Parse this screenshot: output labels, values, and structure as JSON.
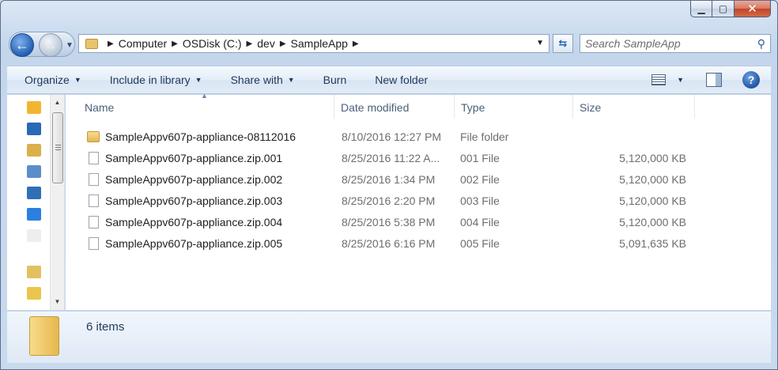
{
  "window": {
    "minimize_glyph": "▁",
    "maximize_glyph": "▢",
    "close_glyph": "✕"
  },
  "address_bar": {
    "crumbs": [
      "Computer",
      "OSDisk (C:)",
      "dev",
      "SampleApp"
    ]
  },
  "search": {
    "placeholder": "Search SampleApp"
  },
  "toolbar": {
    "organize_label": "Organize",
    "include_label": "Include in library",
    "share_label": "Share with",
    "burn_label": "Burn",
    "new_folder_label": "New folder"
  },
  "columns": {
    "name": "Name",
    "date": "Date modified",
    "type": "Type",
    "size": "Size"
  },
  "files": [
    {
      "name": "SampleAppv607p-appliance-08112016",
      "date": "8/10/2016 12:27 PM",
      "type": "File folder",
      "size": "",
      "icon": "folder-icon"
    },
    {
      "name": "SampleAppv607p-appliance.zip.001",
      "date": "8/25/2016 11:22 A...",
      "type": "001 File",
      "size": "5,120,000 KB",
      "icon": "file-icon"
    },
    {
      "name": "SampleAppv607p-appliance.zip.002",
      "date": "8/25/2016 1:34 PM",
      "type": "002 File",
      "size": "5,120,000 KB",
      "icon": "file-icon"
    },
    {
      "name": "SampleAppv607p-appliance.zip.003",
      "date": "8/25/2016 2:20 PM",
      "type": "003 File",
      "size": "5,120,000 KB",
      "icon": "file-icon"
    },
    {
      "name": "SampleAppv607p-appliance.zip.004",
      "date": "8/25/2016 5:38 PM",
      "type": "004 File",
      "size": "5,120,000 KB",
      "icon": "file-icon"
    },
    {
      "name": "SampleAppv607p-appliance.zip.005",
      "date": "8/25/2016 6:16 PM",
      "type": "005 File",
      "size": "5,091,635 KB",
      "icon": "file-icon"
    }
  ],
  "details": {
    "count_label": "6 items"
  },
  "nav_pane": {
    "icons": [
      "favorites-star-icon",
      "desktop-icon",
      "downloads-folder-icon",
      "network-icon",
      "sharepoint-icon",
      "dropbox-icon",
      "document-icon",
      "folder-icon",
      "library-icon"
    ],
    "icon_colors": [
      "#f2b531",
      "#2a68b8",
      "#d9b04a",
      "#5b8ec9",
      "#2f6fb7",
      "#2b7fe0",
      "#eeeeee",
      "#e3c05f",
      "#e9c64d"
    ]
  },
  "colors": {
    "accent": "#1e395b",
    "back_button": "#2460b4"
  }
}
